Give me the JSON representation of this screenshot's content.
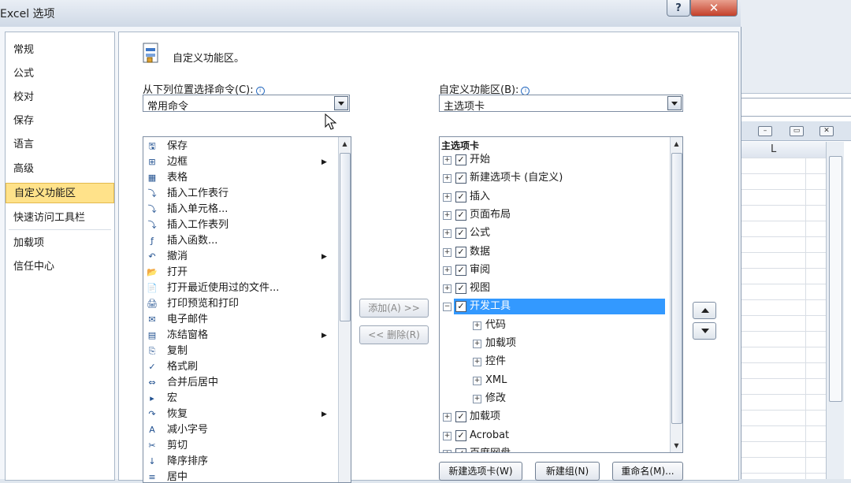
{
  "window": {
    "title": "Excel 选项",
    "help": "?",
    "close": "✕"
  },
  "nav": {
    "items": [
      {
        "label": "常规"
      },
      {
        "label": "公式"
      },
      {
        "label": "校对"
      },
      {
        "label": "保存"
      },
      {
        "label": "语言"
      },
      {
        "label": "高级"
      },
      {
        "label": "自定义功能区"
      },
      {
        "label": "快速访问工具栏"
      },
      {
        "label": "加载项"
      },
      {
        "label": "信任中心"
      }
    ],
    "selected": "自定义功能区"
  },
  "header": {
    "text": "自定义功能区。"
  },
  "left": {
    "label": "从下列位置选择命令(C):",
    "combo_value": "常用命令",
    "commands": [
      {
        "label": "保存",
        "icon": "save-icon",
        "glyph": "🖫",
        "submenu": false
      },
      {
        "label": "边框",
        "icon": "border-icon",
        "glyph": "⊞",
        "submenu": true
      },
      {
        "label": "表格",
        "icon": "table-icon",
        "glyph": "▦",
        "submenu": false
      },
      {
        "label": "插入工作表行",
        "icon": "insert-row-icon",
        "glyph": "⤵",
        "submenu": false
      },
      {
        "label": "插入单元格...",
        "icon": "insert-cell-icon",
        "glyph": "⤵",
        "submenu": false
      },
      {
        "label": "插入工作表列",
        "icon": "insert-column-icon",
        "glyph": "⤵",
        "submenu": false
      },
      {
        "label": "插入函数...",
        "icon": "function-icon",
        "glyph": "ƒ",
        "submenu": false
      },
      {
        "label": "撤消",
        "icon": "undo-icon",
        "glyph": "↶",
        "submenu": true
      },
      {
        "label": "打开",
        "icon": "open-folder-icon",
        "glyph": "📂",
        "submenu": false
      },
      {
        "label": "打开最近使用过的文件...",
        "icon": "recent-file-icon",
        "glyph": "📄",
        "submenu": false
      },
      {
        "label": "打印预览和打印",
        "icon": "print-preview-icon",
        "glyph": "🖨",
        "submenu": false
      },
      {
        "label": "电子邮件",
        "icon": "email-icon",
        "glyph": "✉",
        "submenu": false
      },
      {
        "label": "冻结窗格",
        "icon": "freeze-panes-icon",
        "glyph": "▤",
        "submenu": true
      },
      {
        "label": "复制",
        "icon": "copy-icon",
        "glyph": "⎘",
        "submenu": false
      },
      {
        "label": "格式刷",
        "icon": "format-painter-icon",
        "glyph": "✓",
        "submenu": false
      },
      {
        "label": "合并后居中",
        "icon": "merge-center-icon",
        "glyph": "⇔",
        "submenu": false
      },
      {
        "label": "宏",
        "icon": "macro-icon",
        "glyph": "▸",
        "submenu": false
      },
      {
        "label": "恢复",
        "icon": "redo-icon",
        "glyph": "↷",
        "submenu": true
      },
      {
        "label": "减小字号",
        "icon": "decrease-font-icon",
        "glyph": "A",
        "submenu": false
      },
      {
        "label": "剪切",
        "icon": "cut-icon",
        "glyph": "✂",
        "submenu": false
      },
      {
        "label": "降序排序",
        "icon": "sort-desc-icon",
        "glyph": "↓",
        "submenu": false
      },
      {
        "label": "居中",
        "icon": "center-align-icon",
        "glyph": "≡",
        "submenu": false
      }
    ]
  },
  "middle": {
    "add_label": "添加(A) >>",
    "remove_label": "<< 删除(R)"
  },
  "right": {
    "label": "自定义功能区(B):",
    "combo_value": "主选项卡",
    "tree_header": "主选项卡",
    "tabs": [
      {
        "label": "开始",
        "level": 0,
        "expander": "+",
        "checked": true
      },
      {
        "label": "新建选项卡 (自定义)",
        "level": 0,
        "expander": "+",
        "checked": true
      },
      {
        "label": "插入",
        "level": 0,
        "expander": "+",
        "checked": true
      },
      {
        "label": "页面布局",
        "level": 0,
        "expander": "+",
        "checked": true
      },
      {
        "label": "公式",
        "level": 0,
        "expander": "+",
        "checked": true
      },
      {
        "label": "数据",
        "level": 0,
        "expander": "+",
        "checked": true
      },
      {
        "label": "审阅",
        "level": 0,
        "expander": "+",
        "checked": true
      },
      {
        "label": "视图",
        "level": 0,
        "expander": "+",
        "checked": true
      },
      {
        "label": "开发工具",
        "level": 0,
        "expander": "−",
        "checked": true,
        "selected": true
      },
      {
        "label": "代码",
        "level": 1,
        "expander": "+"
      },
      {
        "label": "加载项",
        "level": 1,
        "expander": "+"
      },
      {
        "label": "控件",
        "level": 1,
        "expander": "+"
      },
      {
        "label": "XML",
        "level": 1,
        "expander": "+"
      },
      {
        "label": "修改",
        "level": 1,
        "expander": "+"
      },
      {
        "label": "加载项",
        "level": 0,
        "expander": "+",
        "checked": true
      },
      {
        "label": "Acrobat",
        "level": 0,
        "expander": "+",
        "checked": true
      },
      {
        "label": "百度网盘",
        "level": 0,
        "expander": "+",
        "checked": true
      }
    ],
    "buttons": {
      "new_tab": "新建选项卡(W)",
      "new_group": "新建组(N)",
      "rename": "重命名(M)..."
    }
  },
  "excel_background": {
    "column_label": "L"
  },
  "colors": {
    "nav_selected": "#ffe28a",
    "tree_selected": "#3399ff",
    "close_button": "#c4402a"
  }
}
